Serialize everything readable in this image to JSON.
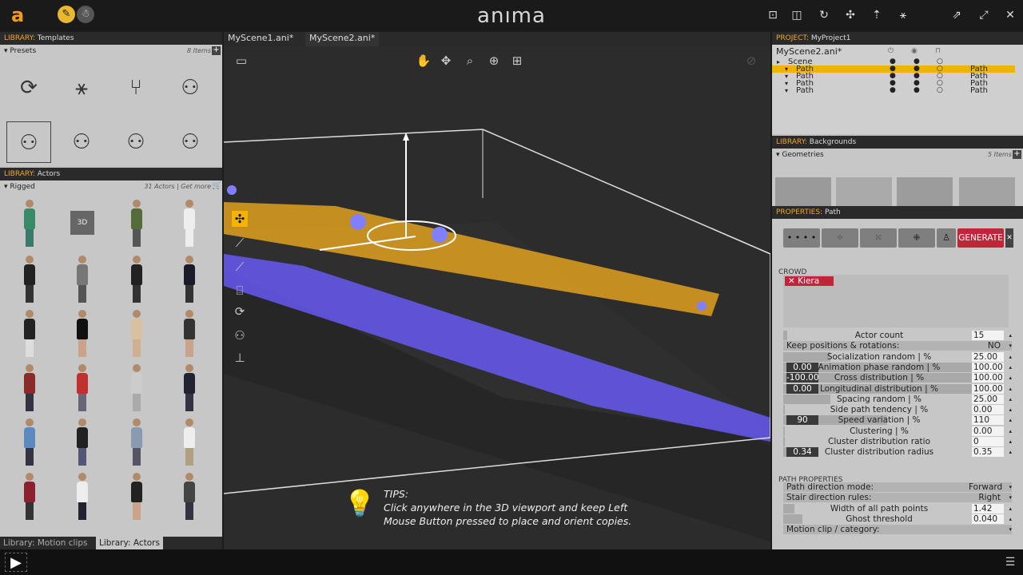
{
  "brand": "anıma",
  "tabs": [
    "MyScene1.ani*",
    "MyScene2.ani*"
  ],
  "left": {
    "templates_header_prefix": "LIBRARY:",
    "templates_header_name": "Templates",
    "presets_label": "Presets",
    "presets_count": "8 Items",
    "actors_header_prefix": "LIBRARY:",
    "actors_header_name": "Actors",
    "rigged_label": "Rigged",
    "actors_count": "31 Actors | Get more",
    "bottom_tabs": [
      "Library: Motion clips",
      "Library: Actors"
    ]
  },
  "project": {
    "header_prefix": "PROJECT:",
    "header_name": "MyProject1",
    "file": "MyScene2.ani*",
    "tree": [
      {
        "label": "Scene",
        "type": "",
        "selected": false
      },
      {
        "label": "Path",
        "type": "Path",
        "selected": true
      },
      {
        "label": "Path",
        "type": "Path",
        "selected": false
      },
      {
        "label": "Path",
        "type": "Path",
        "selected": false
      },
      {
        "label": "Path",
        "type": "Path",
        "selected": false
      }
    ]
  },
  "backgrounds": {
    "header_prefix": "LIBRARY:",
    "header_name": "Backgrounds",
    "geometries_label": "Geometries",
    "count": "5 Items"
  },
  "properties": {
    "header_prefix": "PROPERTIES:",
    "header_name": "Path",
    "generate_label": "GENERATE",
    "crowd_label": "CROWD",
    "crowd_tag": "Kiera",
    "rows": [
      {
        "label": "Actor count",
        "value": "15",
        "left": "",
        "bar": 0.02
      },
      {
        "label": "Keep positions & rotations:",
        "select": "NO"
      },
      {
        "label": "Socialization random | %",
        "value": "25.00",
        "left": "",
        "bar": 0.25
      },
      {
        "label": "Animation phase random | %",
        "value": "100.00",
        "left": "0.00",
        "bar": 1.0
      },
      {
        "label": "Cross distribution | %",
        "value": "100.00",
        "left": "-100.00",
        "bar": 1.0
      },
      {
        "label": "Longitudinal distribution | %",
        "value": "100.00",
        "left": "0.00",
        "bar": 1.0
      },
      {
        "label": "Spacing random | %",
        "value": "25.00",
        "left": "",
        "bar": 0.25
      },
      {
        "label": "Side path tendency | %",
        "value": "0.00",
        "left": "",
        "bar": 0.0
      },
      {
        "label": "Speed variation | %",
        "value": "110",
        "left": "90",
        "bar": 0.55
      },
      {
        "label": "Clustering | %",
        "value": "0.00",
        "left": "",
        "bar": 0.0
      },
      {
        "label": "Cluster distribution ratio",
        "value": "0",
        "left": "",
        "bar": 0.0
      },
      {
        "label": "Cluster distribution radius",
        "value": "0.35",
        "left": "0.34",
        "bar": 0.02
      }
    ],
    "path_props_label": "PATH PROPERTIES",
    "path_rows": [
      {
        "label": "Path direction mode:",
        "select": "Forward"
      },
      {
        "label": "Stair direction rules:",
        "select": "Right"
      },
      {
        "label": "Width of all path points",
        "value": "1.42",
        "bar": 0.06
      },
      {
        "label": "Ghost threshold",
        "value": "0.040",
        "bar": 0.1
      },
      {
        "label": "Motion clip / category:",
        "select": ""
      }
    ]
  },
  "tips": {
    "title": "TIPS:",
    "line1": "Click anywhere in the 3D viewport and keep Left",
    "line2": "Mouse Button pressed to place and orient copies."
  },
  "colors": {
    "accent": "#f2a52c",
    "generate": "#c0253a",
    "path_orange": "#e0a020",
    "path_blue": "#6a5cff"
  }
}
